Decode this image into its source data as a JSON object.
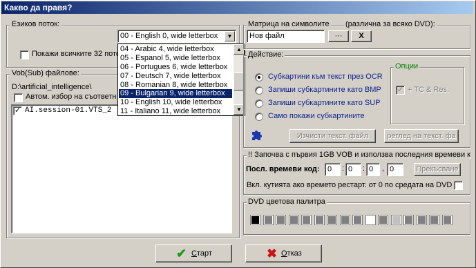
{
  "window": {
    "title": "Какво да правя?"
  },
  "language": {
    "group_label": "Езиков поток:",
    "selected": "00 - English 0, wide letterbox",
    "show_all_label": "Покажи всичките 32 пото",
    "options": [
      "04 - Arabic 4, wide letterbox",
      "05 - Espanol 5, wide letterbox",
      "06 - Portugues 6, wide letterbox",
      "07 - Deutsch 7, wide letterbox",
      "08 - Romanian 8, wide letterbox",
      "09 - Bulgarian 9, wide letterbox",
      "10 - English 10, wide letterbox",
      "11 - Italiano 11, wide letterbox"
    ],
    "highlighted": "09 - Bulgarian 9, wide letterbox"
  },
  "vob": {
    "group_label": "Vob(Sub) файлове:",
    "path": "D:\\artificial_intelligence\\",
    "auto_select_label": "Автом. избор на съответн",
    "files": [
      {
        "name": "AI.session-01.VTS_2",
        "checked": true
      }
    ]
  },
  "charmatrix": {
    "label": "Матрица на символите",
    "note": "(различна за всяко DVD):",
    "value": "Нов файл",
    "browse": "···",
    "clear": "X"
  },
  "action": {
    "group_label": "Действие:",
    "options": [
      {
        "label": "Субкартини към текст през OCR",
        "selected": true
      },
      {
        "label": "Запиши субкартините като BMP",
        "selected": false
      },
      {
        "label": "Запиши субкартините като SUP",
        "selected": false
      },
      {
        "label": "Само покажи субкартините",
        "selected": false
      }
    ],
    "clear_text": "Изчисти текст. файл",
    "view_text": "реглед на текст. фа"
  },
  "options": {
    "group_label": "Опции",
    "tc_label": "+ TC & Res."
  },
  "time": {
    "note": "!! Започва с първия 1GB VOB и използва последния времеви к",
    "code_label": "Посл. времеви код:",
    "values": [
      "0",
      "0",
      "0",
      "0"
    ],
    "interrupt": "Прекъсване",
    "include_label": "Вкл. кутията ако времето рестарт. от 0 по средата на DVD"
  },
  "palette": {
    "group_label": "DVD цветова палитра",
    "colors": [
      "#000000",
      "#808080",
      "#808080",
      "#808080",
      "#808080",
      "#808080",
      "#808080",
      "#808080",
      "#808080",
      "#ffffff",
      "#808080",
      "#c0c0c0",
      "#808080",
      "#808080",
      "#808080",
      "#808080"
    ]
  },
  "footer": {
    "start": "Старт",
    "cancel": "Отказ",
    "start_u": "С",
    "cancel_u": "О"
  },
  "colors": {
    "options_label": "#008000",
    "accent": "#0a246a"
  }
}
